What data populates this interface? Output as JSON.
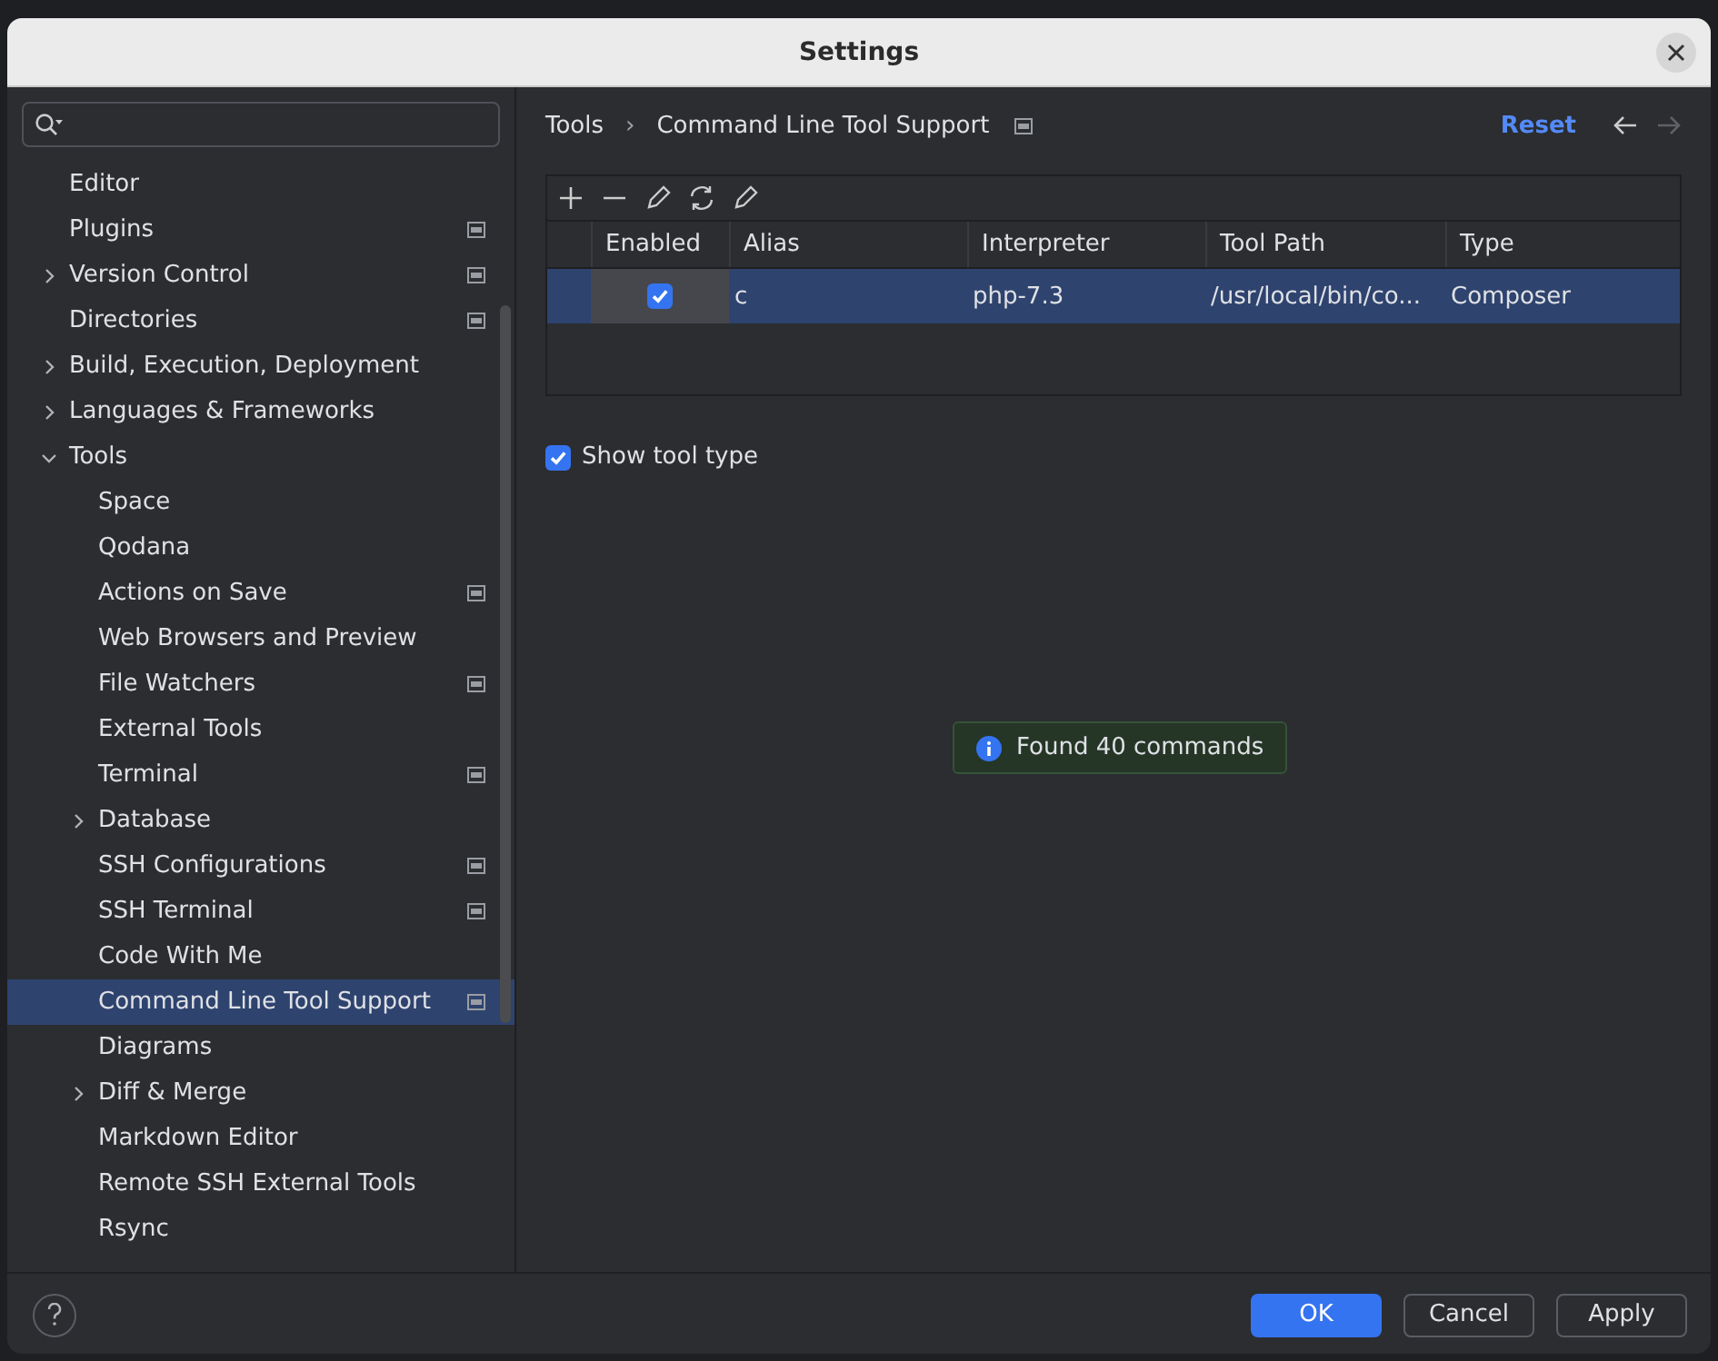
{
  "window": {
    "title": "Settings"
  },
  "sidebar": {
    "items": [
      {
        "label": "Editor",
        "badge": false,
        "selected": false
      },
      {
        "label": "Plugins",
        "badge": true,
        "selected": false
      },
      {
        "label": "Version Control",
        "badge": true,
        "selected": false,
        "expanded": false
      },
      {
        "label": "Directories",
        "badge": true,
        "selected": false
      },
      {
        "label": "Build, Execution, Deployment",
        "badge": false,
        "selected": false,
        "expanded": false
      },
      {
        "label": "Languages & Frameworks",
        "badge": false,
        "selected": false,
        "expanded": false
      },
      {
        "label": "Tools",
        "badge": false,
        "selected": false,
        "expanded": true,
        "children": [
          {
            "label": "Space",
            "badge": false,
            "selected": false
          },
          {
            "label": "Qodana",
            "badge": false,
            "selected": false
          },
          {
            "label": "Actions on Save",
            "badge": true,
            "selected": false
          },
          {
            "label": "Web Browsers and Preview",
            "badge": false,
            "selected": false
          },
          {
            "label": "File Watchers",
            "badge": true,
            "selected": false
          },
          {
            "label": "External Tools",
            "badge": false,
            "selected": false
          },
          {
            "label": "Terminal",
            "badge": true,
            "selected": false
          },
          {
            "label": "Database",
            "badge": false,
            "selected": false,
            "expanded": false
          },
          {
            "label": "SSH Configurations",
            "badge": true,
            "selected": false
          },
          {
            "label": "SSH Terminal",
            "badge": true,
            "selected": false
          },
          {
            "label": "Code With Me",
            "badge": false,
            "selected": false
          },
          {
            "label": "Command Line Tool Support",
            "badge": true,
            "selected": true
          },
          {
            "label": "Diagrams",
            "badge": false,
            "selected": false
          },
          {
            "label": "Diff & Merge",
            "badge": false,
            "selected": false,
            "expanded": false
          },
          {
            "label": "Markdown Editor",
            "badge": false,
            "selected": false
          },
          {
            "label": "Remote SSH External Tools",
            "badge": false,
            "selected": false
          },
          {
            "label": "Rsync",
            "badge": false,
            "selected": false
          }
        ]
      }
    ]
  },
  "breadcrumb": {
    "items": [
      "Tools",
      "Command Line Tool Support"
    ],
    "separator": "›",
    "badge": true
  },
  "reset": "Reset",
  "table": {
    "columns": [
      "Enabled",
      "Alias",
      "Interpreter",
      "Tool Path",
      "Type"
    ],
    "rows": [
      {
        "enabled": true,
        "selected": true,
        "alias": "c",
        "interpreter": "php-7.3",
        "tool_path": "/usr/local/bin/co...",
        "type": "Composer"
      }
    ]
  },
  "show_tool_type": {
    "label": "Show tool type",
    "checked": true
  },
  "notification": "Found 40 commands",
  "buttons": [
    {
      "label": "OK",
      "kind": "primary"
    },
    {
      "label": "Cancel",
      "kind": "normal"
    },
    {
      "label": "Apply",
      "kind": "normal"
    }
  ]
}
